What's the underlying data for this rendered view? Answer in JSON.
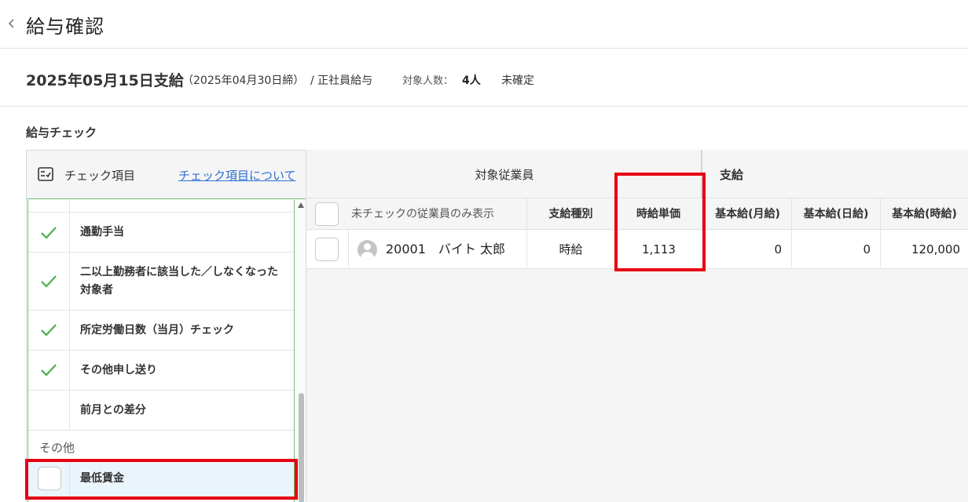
{
  "header": {
    "back_icon": "chevron-left-icon",
    "title": "給与確認"
  },
  "info": {
    "pay_date": "2025年05月15日支給",
    "close_date": "（2025年04月30日締）",
    "pay_type": "/ 正社員給与",
    "count_label": "対象人数：",
    "count_value": "4人",
    "status": "未確定"
  },
  "section_title": "給与チェック",
  "check_panel": {
    "header_icon": "checklist-icon",
    "header_label": "チェック項目",
    "about_link": "チェック項目について",
    "items": [
      {
        "label": "通勤手当",
        "checked": true
      },
      {
        "label": "二以上勤務者に該当した／しなくなった対象者",
        "checked": true
      },
      {
        "label": "所定労働日数（当月）チェック",
        "checked": true
      },
      {
        "label": "その他申し送り",
        "checked": true
      },
      {
        "label": "前月との差分",
        "checked": false
      }
    ],
    "group_other": "その他",
    "other_items": [
      {
        "label": "最低賃金",
        "checked": false,
        "selected": true
      }
    ]
  },
  "table": {
    "group_employee": "対象従業員",
    "group_pay": "支給",
    "filter_label": "未チェックの従業員のみ表示",
    "columns": [
      "支給種別",
      "時給単価",
      "基本給(月給)",
      "基本給(日給)",
      "基本給(時給)"
    ],
    "rows": [
      {
        "employee": "20001　バイト 太郎",
        "pay_kind": "時給",
        "hourly_rate": "1,113",
        "base_monthly": "0",
        "base_daily": "0",
        "base_hourly": "120,000"
      }
    ]
  },
  "colors": {
    "accent_link": "#2f6fd6",
    "check_green": "#4caf50",
    "highlight_red": "#e60012"
  }
}
